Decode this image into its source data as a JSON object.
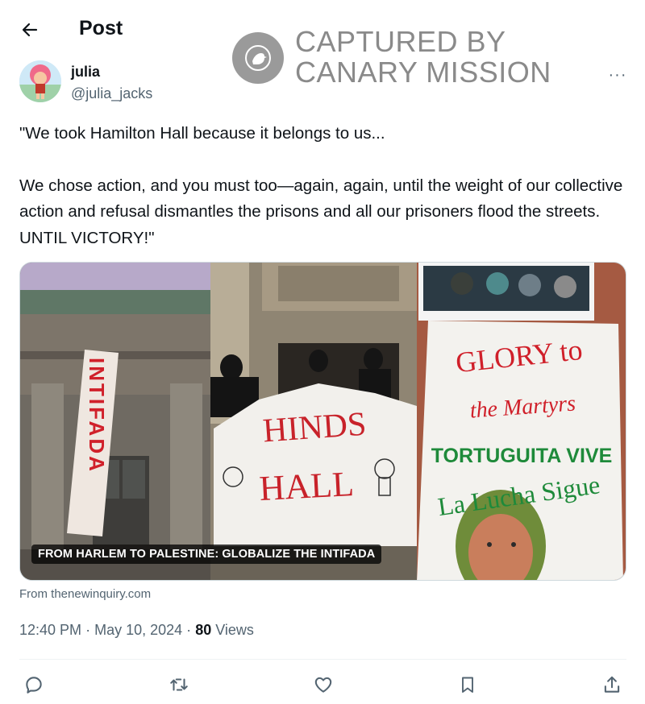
{
  "header": {
    "title": "Post",
    "back_icon": "arrow-left-icon"
  },
  "watermark": {
    "line1": "CAPTURED BY",
    "line2": "CANARY MISSION",
    "logo_icon": "canary-bird-icon"
  },
  "author": {
    "display_name": "julia",
    "handle": "@julia_jacks",
    "more_label": "···"
  },
  "tweet": {
    "paragraph1": "\"We took Hamilton Hall because it belongs to us...",
    "paragraph2": "We chose action, and you must too—again, again, until the weight of our collective action and refusal dismantles the prisons and all our prisoners flood the streets. UNTIL VICTORY!\""
  },
  "media": {
    "caption": "FROM HARLEM TO PALESTINE: GLOBALIZE THE INTIFADA",
    "banner_left": "INTIFADA",
    "banner_middle_line1": "HINDS",
    "banner_middle_line2": "HALL",
    "banner_right_line1": "GLORY to",
    "banner_right_line2": "the Martyrs",
    "banner_right_line3": "TORTUGUITA VIVE",
    "banner_right_line4": "La Lucha Sigue"
  },
  "source": "From thenewinquiry.com",
  "meta": {
    "time": "12:40 PM",
    "separator": "·",
    "date": "May 10, 2024",
    "views_count": "80",
    "views_label": "Views"
  },
  "actions": {
    "reply_icon": "reply-icon",
    "retweet_icon": "retweet-icon",
    "like_icon": "heart-icon",
    "bookmark_icon": "bookmark-icon",
    "share_icon": "share-icon"
  },
  "colors": {
    "text_primary": "#0f1419",
    "text_secondary": "#536471",
    "watermark": "#8a8a8a",
    "banner_red": "#d0202a",
    "banner_green": "#1e8a3a"
  }
}
